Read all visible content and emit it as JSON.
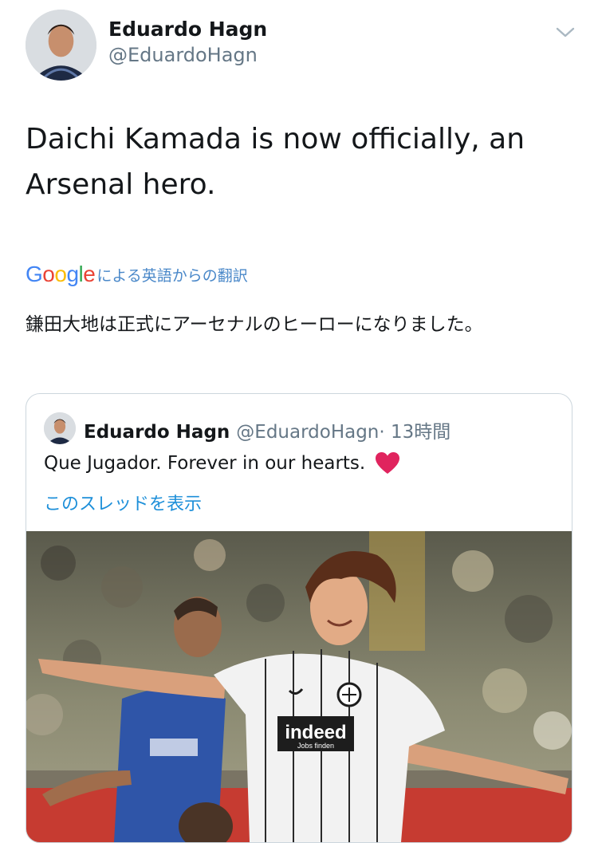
{
  "tweet": {
    "author_name": "Eduardo Hagn",
    "author_handle": "@EduardoHagn",
    "text": "Daichi Kamada is now officially, an Arsenal hero.",
    "menu_icon": "chevron-down-icon"
  },
  "translation": {
    "logo_letters": [
      "G",
      "o",
      "o",
      "g",
      "l",
      "e"
    ],
    "logo_colors": [
      "#4285F4",
      "#EA4335",
      "#FBBC05",
      "#4285F4",
      "#34A853",
      "#EA4335"
    ],
    "label": "による英語からの翻訳",
    "text": "鎌田大地は正式にアーセナルのヒーローになりました。"
  },
  "quoted_tweet": {
    "author_name": "Eduardo Hagn",
    "author_handle": "@EduardoHagn",
    "time": "· 13時間",
    "text": "Que Jugador. Forever in our hearts.",
    "emoji_icon": "red-heart-icon",
    "thread_link": "このスレッドを表示",
    "photo_sponsor": "indeed",
    "photo_sponsor_tag": "Jobs finden"
  },
  "colors": {
    "link": "#1d8fd9",
    "secondary_text": "#657786",
    "border": "#ccd6dd",
    "heart": "#e0245e"
  }
}
